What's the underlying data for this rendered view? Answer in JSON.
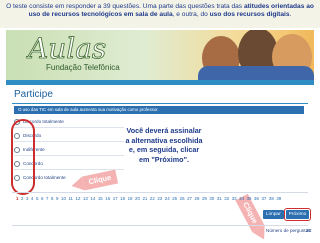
{
  "banner": {
    "part1": "O teste consiste em responder a 39 questões. Uma parte das questões trata das ",
    "bold1": "atitudes orientadas ao uso de recursos tecnológicos em sala de aula",
    "part2": ", e outra, do ",
    "bold2": "uso dos recursos digitais",
    "part3": "."
  },
  "header": {
    "logo_title": "Aulas",
    "logo_subtitle": "Fundação Telefônica"
  },
  "page": {
    "title": "Participe"
  },
  "question": {
    "text": "O uso das TIC em sala de aula aumenta sua motivação como professor."
  },
  "options": [
    {
      "label": "Discordo totalmente"
    },
    {
      "label": "Discordo"
    },
    {
      "label": "Indiferente"
    },
    {
      "label": "Concordo"
    },
    {
      "label": "Concordo totalmente"
    }
  ],
  "callout": {
    "text": "Você deverá assinalar a alternativa escolhida e, em seguida, clicar em \"Próximo\"."
  },
  "annotations": {
    "left_label": "Clique",
    "right_label": "Clique"
  },
  "pagination": {
    "pages": [
      "1",
      "2",
      "3",
      "4",
      "5",
      "6",
      "7",
      "8",
      "9",
      "10",
      "11",
      "12",
      "13",
      "14",
      "15",
      "16",
      "17",
      "18",
      "19",
      "20",
      "21",
      "22",
      "23",
      "24",
      "25",
      "26",
      "27",
      "28",
      "29",
      "30",
      "31",
      "32",
      "33",
      "34",
      "35",
      "36",
      "37",
      "38",
      "39"
    ],
    "current": "1"
  },
  "navigation": {
    "clear_label": "Limpar",
    "next_label": "Próximo"
  },
  "footer": {
    "questions_label": "Número de perguntas:",
    "questions_count": "20"
  },
  "colors": {
    "brand_blue": "#2b6fb0",
    "highlight_red": "#cc2e2e",
    "callout_pink": "#f4b2b2",
    "title_blue": "#1e3a8a"
  }
}
